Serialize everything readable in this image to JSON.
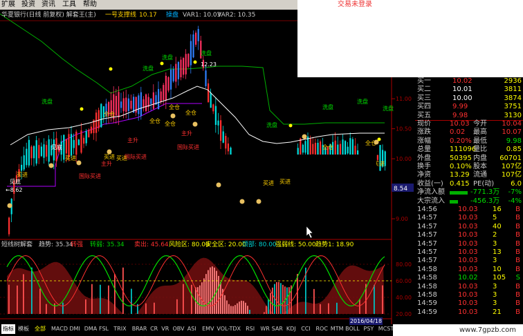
{
  "menu": {
    "items": [
      "扩展",
      "投资",
      "资讯",
      "工具",
      "帮助"
    ],
    "alert": "交易未登录"
  },
  "stock": {
    "title": "华夏银行(日线 前复权) 解套王(主)",
    "support_label": "一号支撑线",
    "support_value": "10.17",
    "mid_label": "操盘",
    "mid_value": "",
    "var1": "VAR1: 10.03",
    "var2": "VAR2: 10.35"
  },
  "axis": {
    "main_ticks": [
      "11.50",
      "11.00",
      "10.50",
      "10.00",
      "9.50",
      "9.00"
    ],
    "current_price": "8.54",
    "high_label": "12.23",
    "low_label": "8.62",
    "sub_ticks": [
      "80.00",
      "60.00",
      "40.00",
      "20.00"
    ]
  },
  "sub": {
    "title": "短线树解套",
    "trend": "趋势: 35.34",
    "turn_strong": "转强",
    "turn_weak": "转弱: 35.34",
    "sell": "卖出: 45.64",
    "risk": "风险区: 80.00",
    "safe": "安全区: 20.00",
    "top": "顶部: 80.00",
    "strong": "强弱线: 50.00",
    "buy": "趋势1: 18.90"
  },
  "annotations": {
    "wash": "洗盘",
    "buy_in": "买进",
    "see_bottom": "见底",
    "full_pos": "全仓",
    "main_rise": "主升",
    "state_buy": "国际买进"
  },
  "quote": {
    "asks": [
      {
        "label": "卖一",
        "price": "",
        "vol": ""
      },
      {
        "label": "卖二",
        "price": "",
        "vol": ""
      },
      {
        "label": "卖三",
        "price": "",
        "vol": ""
      },
      {
        "label": "卖四",
        "price": "",
        "vol": ""
      },
      {
        "label": "卖五",
        "price": "",
        "vol": ""
      }
    ],
    "bids": [
      {
        "label": "买一",
        "price": "10.02",
        "vol": "2936"
      },
      {
        "label": "买二",
        "price": "10.01",
        "vol": "3811"
      },
      {
        "label": "买三",
        "price": "10.00",
        "vol": "3874"
      },
      {
        "label": "买四",
        "price": "9.99",
        "vol": "3751"
      },
      {
        "label": "买五",
        "price": "9.98",
        "vol": "3130"
      }
    ],
    "stats": [
      {
        "l1": "现价",
        "v1": "10.03",
        "l2": "今开",
        "v2": "10.04"
      },
      {
        "l1": "涨跌",
        "v1": "0.02",
        "l2": "最高",
        "v2": "10.07"
      },
      {
        "l1": "涨幅",
        "v1": "0.20%",
        "l2": "最低",
        "v2": "9.98"
      },
      {
        "l1": "总量",
        "v1": "111096",
        "l2": "量比",
        "v2": "0.85"
      },
      {
        "l1": "外盘",
        "v1": "50395",
        "l2": "内盘",
        "v2": "60701"
      }
    ],
    "fund": [
      {
        "l1": "换手",
        "v1": "0.10%",
        "l2": "股本",
        "v2": "107亿"
      },
      {
        "l1": "净资",
        "v1": "13.29",
        "l2": "流通",
        "v2": "107亿"
      },
      {
        "l1": "收益(一)",
        "v1": "0.415",
        "l2": "PE(动)",
        "v2": "6.0"
      }
    ],
    "flows": [
      {
        "label": "净流入额",
        "value": "-771.3万",
        "pct": "-7%"
      },
      {
        "label": "大宗流入",
        "value": "-456.3万",
        "pct": "-4%"
      }
    ],
    "ticks": [
      {
        "time": "14:56",
        "price": "10.03",
        "vol": "16",
        "side": "B"
      },
      {
        "time": "14:57",
        "price": "10.03",
        "vol": "5",
        "side": "B"
      },
      {
        "time": "14:57",
        "price": "10.03",
        "vol": "40",
        "side": "B"
      },
      {
        "time": "14:57",
        "price": "10.03",
        "vol": "2",
        "side": "B"
      },
      {
        "time": "14:57",
        "price": "10.03",
        "vol": "3",
        "side": "B"
      },
      {
        "time": "14:57",
        "price": "10.03",
        "vol": "13",
        "side": "B"
      },
      {
        "time": "14:57",
        "price": "10.03",
        "vol": "3",
        "side": "B"
      },
      {
        "time": "14:58",
        "price": "10.03",
        "vol": "10",
        "side": "B"
      },
      {
        "time": "14:58",
        "price": "10.02",
        "vol": "105",
        "side": "S"
      },
      {
        "time": "14:58",
        "price": "10.03",
        "vol": "3",
        "side": "B"
      },
      {
        "time": "14:58",
        "price": "10.03",
        "vol": "3",
        "side": "B"
      },
      {
        "time": "14:59",
        "price": "10.03",
        "vol": "3",
        "side": "B"
      },
      {
        "time": "14:59",
        "price": "10.03",
        "vol": "21",
        "side": "B"
      }
    ]
  },
  "tabs": [
    "指标",
    "模板",
    "全部",
    "MACD",
    "DMI",
    "DMA",
    "FSL",
    "TRIX",
    "BRAR",
    "CR",
    "VR",
    "OBV",
    "ASI",
    "EMV",
    "VOL-TDX",
    "RSI",
    "WR",
    "SAR",
    "KDJ",
    "CCI",
    "ROC",
    "MTM",
    "BOLL",
    "PSY",
    "MCST"
  ],
  "date_badge": "2016/04/18",
  "watermark": "www.7gpzb.com",
  "colors": {
    "up": "#ff3030",
    "down": "#00e0e0",
    "wash": "#00dd00",
    "buy_in": "#ffd000",
    "main_rise": "#ff3030",
    "support": "#ffd000",
    "ma1": "#ffffff",
    "ma2": "#ffff00"
  }
}
